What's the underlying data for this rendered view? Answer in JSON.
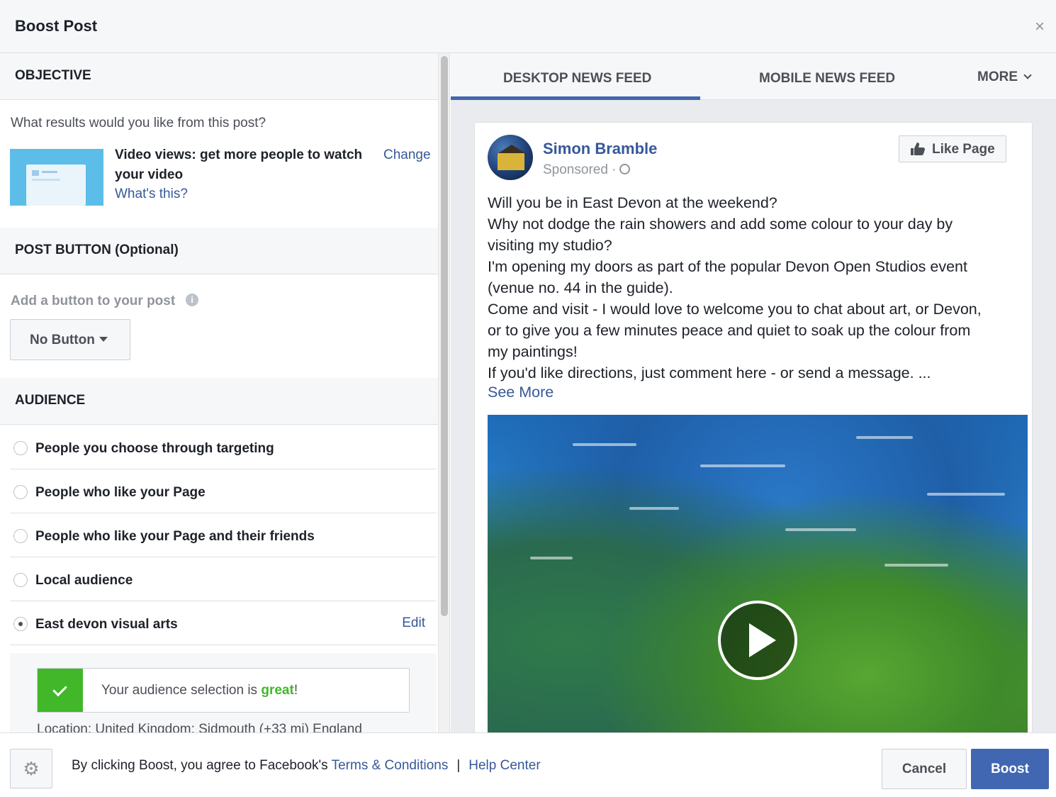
{
  "header": {
    "title": "Boost Post",
    "close_icon": "×"
  },
  "objective": {
    "section_title": "OBJECTIVE",
    "question": "What results would you like from this post?",
    "selected": "Video views: get more people to watch your video",
    "whats_this": "What's this?",
    "change": "Change"
  },
  "post_button": {
    "section_title": "POST BUTTON (Optional)",
    "label": "Add a button to your post",
    "info_icon": "i",
    "select_value": "No Button"
  },
  "audience": {
    "section_title": "AUDIENCE",
    "options": [
      {
        "label": "People you choose through targeting",
        "selected": false
      },
      {
        "label": "People who like your Page",
        "selected": false
      },
      {
        "label": "People who like your Page and their friends",
        "selected": false
      },
      {
        "label": "Local audience",
        "selected": false
      },
      {
        "label": "East devon visual arts",
        "selected": true
      }
    ],
    "edit": "Edit",
    "quality_prefix": "Your audience selection is ",
    "quality_word": "great",
    "quality_suffix": "!",
    "location": "Location: United Kingdom: Sidmouth (+33 mi) England"
  },
  "preview": {
    "tabs": [
      {
        "label": "DESKTOP NEWS FEED",
        "active": true
      },
      {
        "label": "MOBILE NEWS FEED",
        "active": false
      },
      {
        "label": "MORE",
        "active": false
      }
    ],
    "post": {
      "author": "Simon Bramble",
      "sponsored": "Sponsored ·",
      "like_page": "Like Page",
      "text_lines": [
        "Will you be in East Devon at the weekend?",
        "Why not dodge the rain showers and add some colour to your day by",
        "visiting my studio?",
        "I'm opening my doors as part of the popular Devon Open Studios event",
        "(venue no. 44 in the guide).",
        "Come and visit - I would love to welcome you to chat about art, or Devon,",
        "or to give you a few minutes peace and quiet to soak up the colour from",
        "my paintings!",
        "If you'd like directions, just comment here - or send a message. ..."
      ],
      "see_more": "See More"
    }
  },
  "footer": {
    "gear_icon": "⚙",
    "agree_text": "By clicking Boost, you agree to Facebook's ",
    "terms": "Terms & Conditions",
    "separator": "|",
    "help": "Help Center",
    "cancel": "Cancel",
    "boost": "Boost"
  },
  "colors": {
    "accent": "#4267b2",
    "link": "#365899",
    "success": "#42b72a"
  }
}
